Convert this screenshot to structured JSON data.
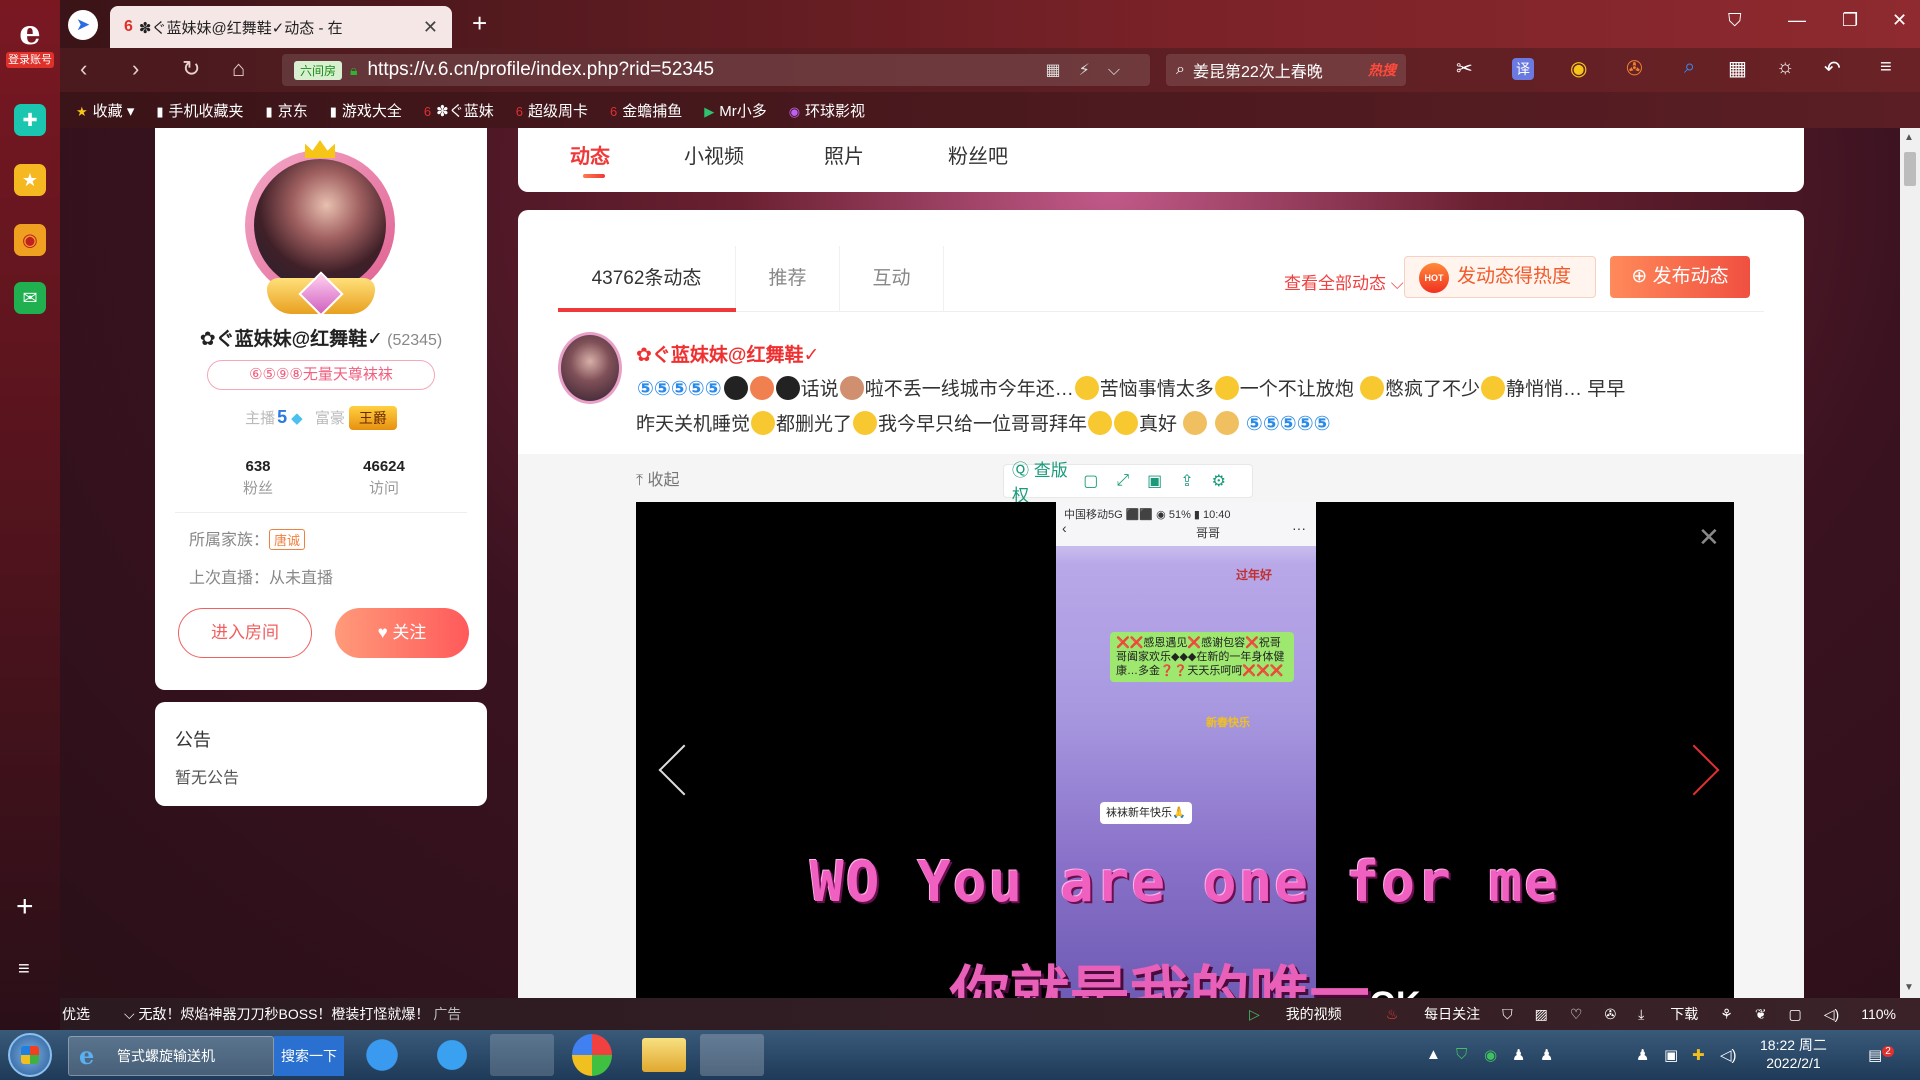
{
  "rail": {
    "logo_letter": "e",
    "login_label": "登录账号",
    "add_label": "+",
    "menu_label": "≡"
  },
  "tab": {
    "title": "✽ぐ蓝妹妹@红舞鞋✓动态 - 在",
    "close": "✕",
    "new_tab": "+"
  },
  "window": {
    "restore": "❐",
    "minimize": "—",
    "maximize": "□",
    "close": "✕",
    "skin": "⛉"
  },
  "nav": {
    "back": "‹",
    "forward": "›",
    "reload": "↻",
    "home": "⌂",
    "url_badge": "六间房",
    "url": "https://v.6.cn/profile/index.php?rid=52345",
    "search_text": "姜昆第22次上春晚",
    "search_hot": "热搜"
  },
  "bookmarks": [
    {
      "icon": "★",
      "label": "收藏"
    },
    {
      "icon": "▮",
      "label": "手机收藏夹"
    },
    {
      "icon": "▮",
      "label": "京东"
    },
    {
      "icon": "▮",
      "label": "游戏大全"
    },
    {
      "icon": "6",
      "label": "✽ぐ蓝妹"
    },
    {
      "icon": "6",
      "label": "超级周卡"
    },
    {
      "icon": "6",
      "label": "金蟾捕鱼"
    },
    {
      "icon": "▶",
      "label": "Mr小多"
    },
    {
      "icon": "◉",
      "label": "环球影视"
    }
  ],
  "profile": {
    "nickname": "✿ぐ蓝妹妹@红舞鞋✓",
    "rid": "(52345)",
    "tagline": "⑥⑤⑨⑧无量天尊袜袜",
    "anchor_label": "主播",
    "anchor_level": "5",
    "rich_label": "富豪",
    "rich_rank": "王爵",
    "fans_value": "638",
    "fans_label": "粉丝",
    "visits_value": "46624",
    "visits_label": "访问",
    "family_label": "所属家族：",
    "family_tag": "唐诚",
    "last_live": "上次直播：从未直播",
    "enter_room": "进入房间",
    "follow": "关注"
  },
  "notice": {
    "title": "公告",
    "content": "暂无公告"
  },
  "tabs": [
    "动态",
    "小视频",
    "照片",
    "粉丝吧"
  ],
  "feed": {
    "count_tab": "43762条动态",
    "recommend_tab": "推荐",
    "interact_tab": "互动",
    "view_all": "查看全部动态 ⌵",
    "hot_label": "发动态得热度",
    "hot_badge": "HOT",
    "post_button": "⊕ 发布动态"
  },
  "post": {
    "author": "✿ぐ蓝妹妹@红舞鞋✓",
    "text_1": "话说",
    "text_2": "啦不丢一线城市今年还…",
    "text_3": "苦恼事情太多",
    "text_4": "一个不让放炮",
    "text_5": "憋疯了不少",
    "text_6": "静悄悄… 早早",
    "text_7": "昨天关机睡觉",
    "text_8": "都删光了",
    "text_9": "我今早只给一位哥哥拜年",
    "text_10": "真好",
    "collapse": "⤒ 收起",
    "tool_copyright": "Ⓠ 查版权",
    "subtitle_en": "WO You are one for me",
    "subtitle_cn": "你就是我的唯一",
    "subtitle_ok": "OK",
    "phone_status": "中国移动5G  ⬛⬛        ◉ 51% ▮ 10:40",
    "phone_contact": "哥哥",
    "bubble_1": "❌❌感恩遇见❌感谢包容❌祝哥哥阖家欢乐◆◆◆在新的一年身体健康…多金❓❓天天乐呵呵❌❌❌",
    "bubble_2": "袜袜新年快乐🙏",
    "sticker_1": "过年好",
    "sticker_2": "新春快乐"
  },
  "statusbar": {
    "today": "今日优选",
    "ad": "无敌！烬焰神器刀刀秒BOSS！橙装打怪就爆！",
    "ad_tag": "广告",
    "my_video": "我的视频",
    "daily_follow": "每日关注",
    "download": "下载",
    "zoom": "110%"
  },
  "taskbar": {
    "app_label": "管式螺旋输送机",
    "search_btn": "搜索一下",
    "time": "18:22 周二",
    "date": "2022/2/1",
    "notif_count": "2"
  }
}
